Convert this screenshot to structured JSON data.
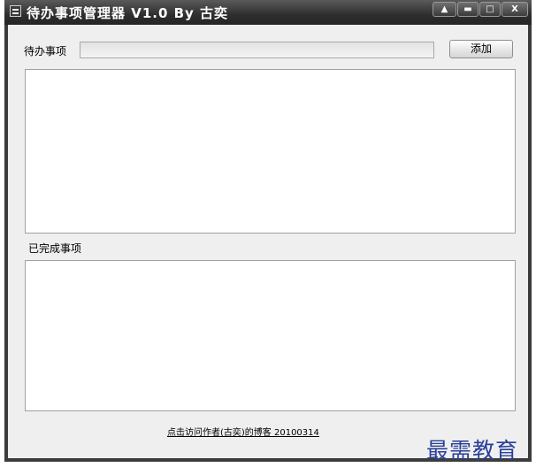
{
  "window": {
    "title": "待办事项管理器 V1.0 By 古奕",
    "controls": {
      "scroll_up": "▲",
      "minimize": "▬",
      "maximize": "□",
      "close": "X"
    }
  },
  "form": {
    "todo_label": "待办事项",
    "todo_value": "",
    "add_button": "添加"
  },
  "completed": {
    "label": "已完成事项"
  },
  "todo_list": {
    "items": []
  },
  "completed_list": {
    "items": []
  },
  "footer": {
    "link_text": "点击访问作者(古奕)的博客  20100314"
  },
  "watermark": {
    "text": "最需教育"
  }
}
